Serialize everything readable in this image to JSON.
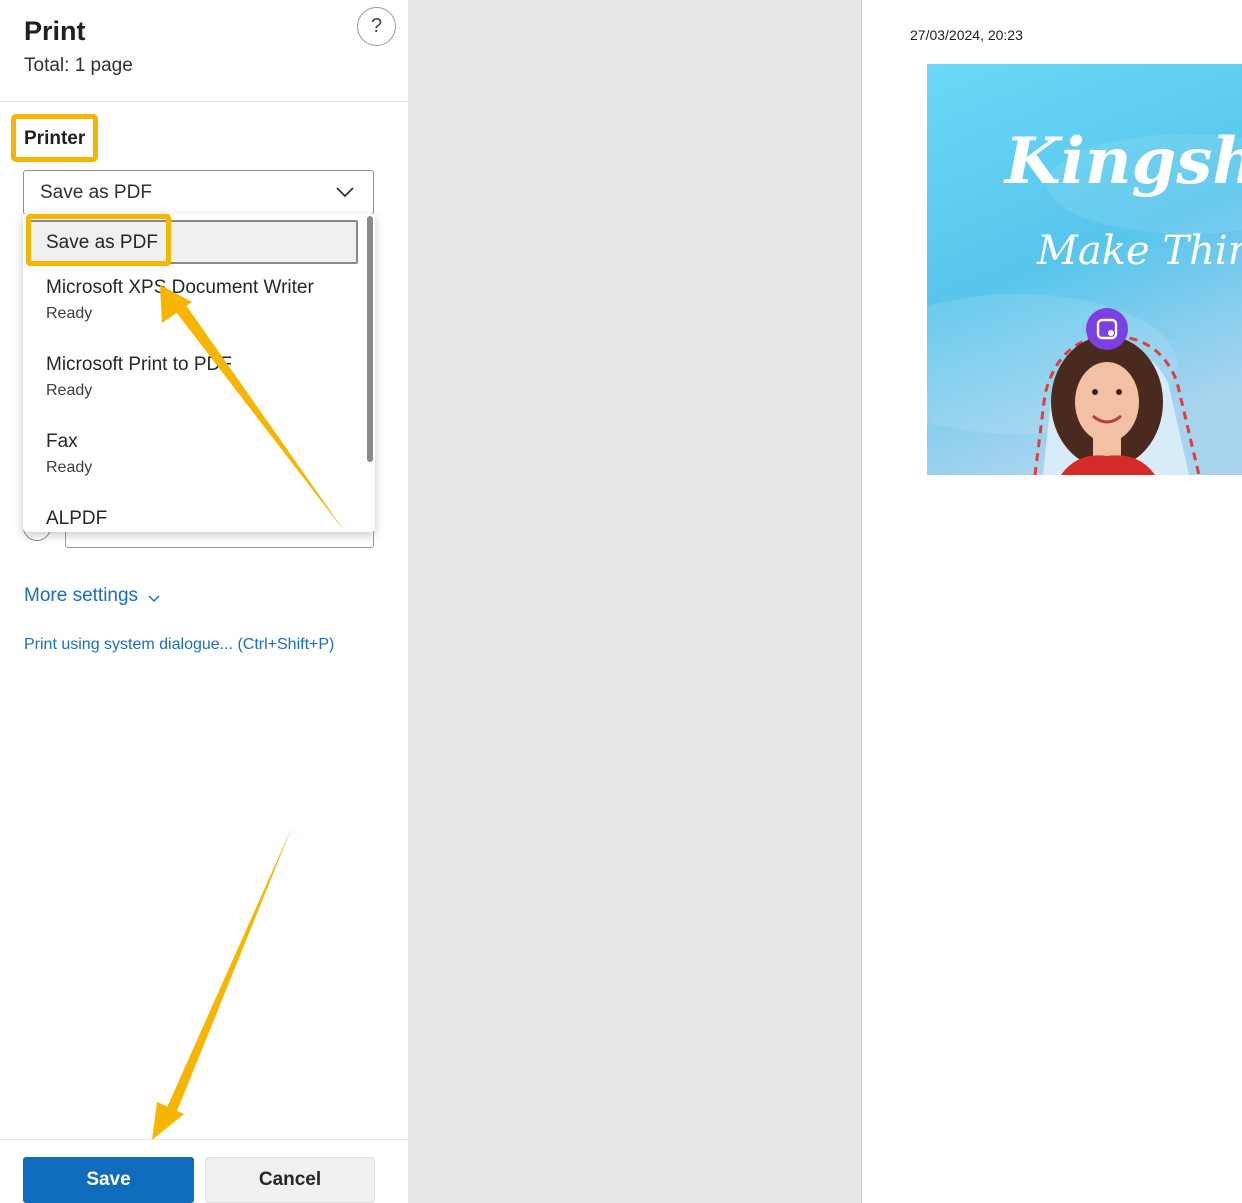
{
  "panel": {
    "title": "Print",
    "subtitle": "Total: 1 page",
    "help_label": "?"
  },
  "printer": {
    "label": "Printer",
    "selected": "Save as PDF",
    "options": [
      {
        "name": "Save as PDF",
        "status": ""
      },
      {
        "name": "Microsoft XPS Document Writer",
        "status": "Ready"
      },
      {
        "name": "Microsoft Print to PDF",
        "status": "Ready"
      },
      {
        "name": "Fax",
        "status": "Ready"
      },
      {
        "name": "ALPDF",
        "status": ""
      }
    ]
  },
  "links": {
    "more_settings": "More settings",
    "system_dialog": "Print using system dialogue... (Ctrl+Shift+P)"
  },
  "actions": {
    "save_label": "Save",
    "cancel_label": "Cancel"
  },
  "preview": {
    "date": "27/03/2024, 20:23",
    "banner_title": "Kingsh",
    "banner_tagline": "Make Thing"
  },
  "colors": {
    "primary": "#0f6cbd",
    "link": "#1a6dbf",
    "highlight": "#f7b500",
    "banner_sky": "#5bcdf0",
    "badge": "#7b3fe4"
  }
}
